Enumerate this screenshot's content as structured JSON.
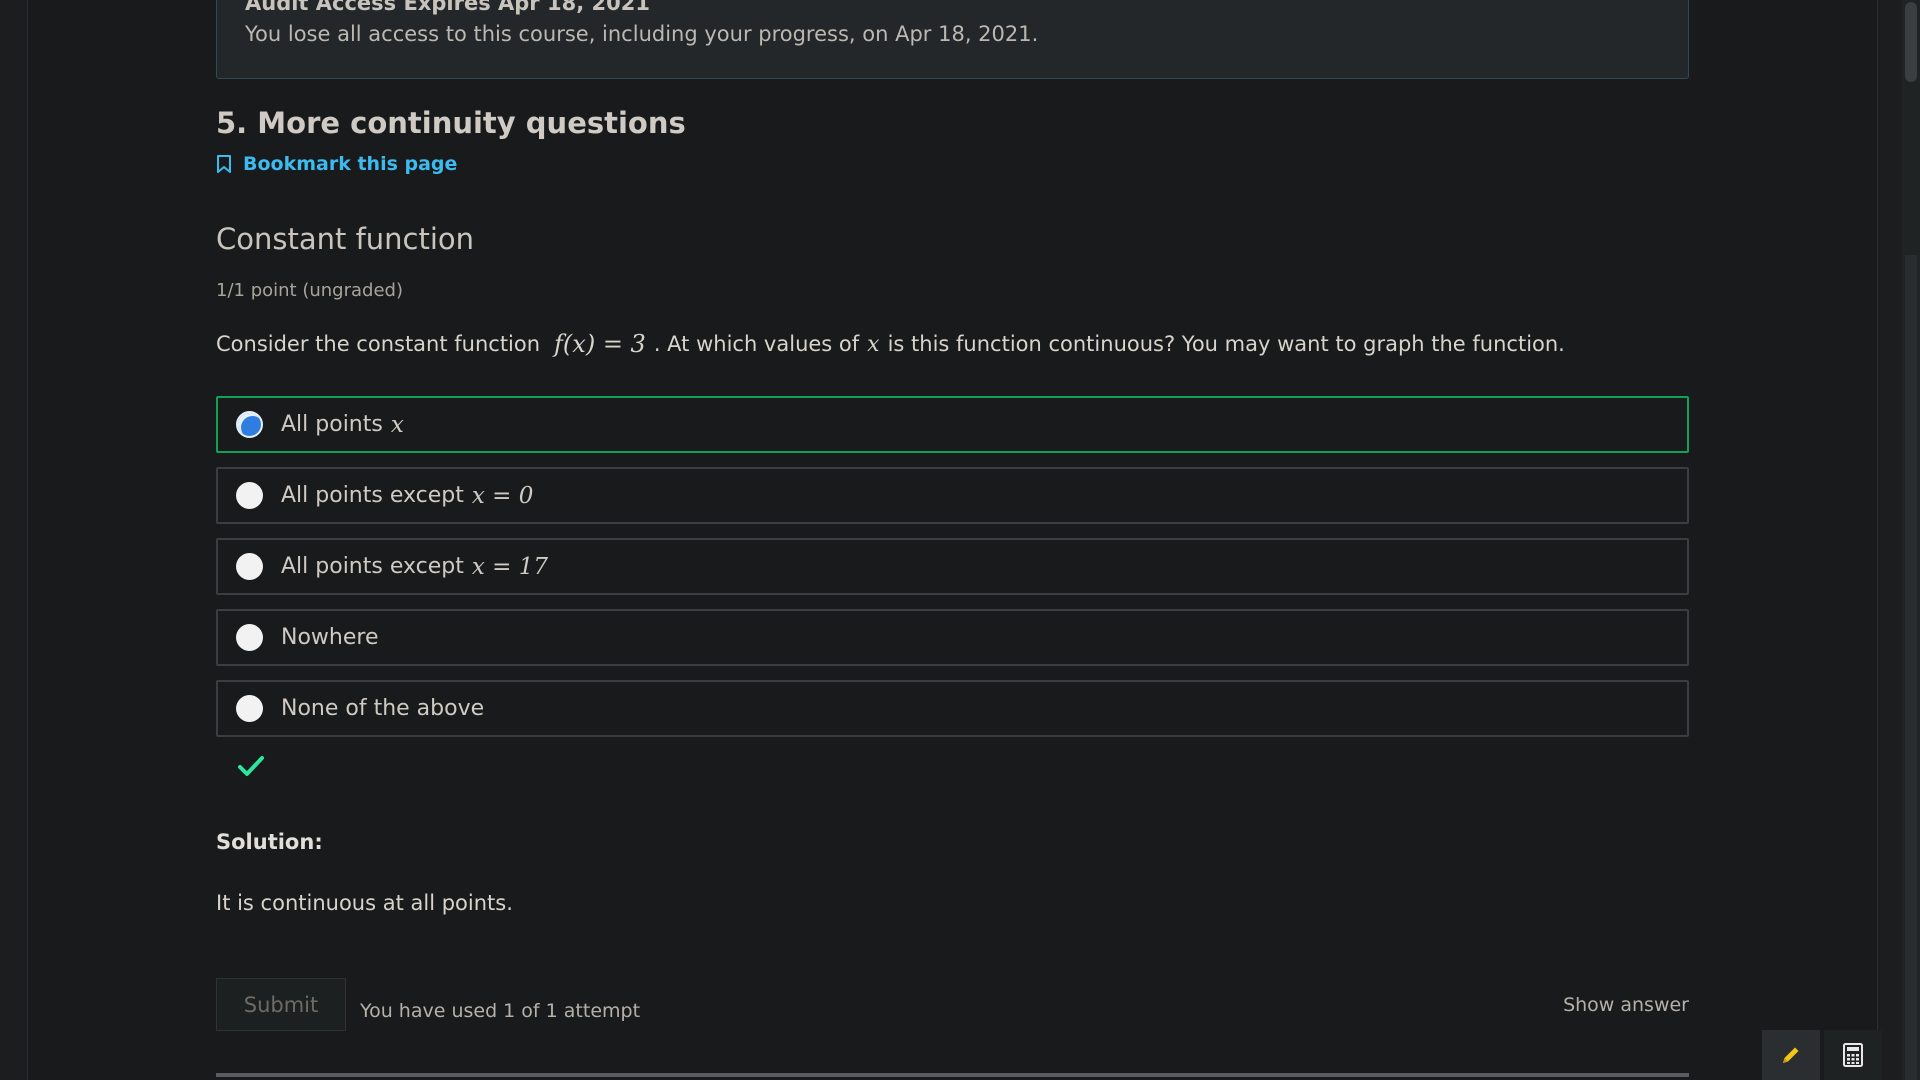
{
  "banner": {
    "title": "Audit Access Expires Apr 18, 2021",
    "text": "You lose all access to this course, including your progress, on Apr 18, 2021."
  },
  "unit": {
    "title": "5. More continuity questions",
    "bookmark_label": "Bookmark this page"
  },
  "problem": {
    "title": "Constant function",
    "points": "1/1 point (ungraded)",
    "question_before": "Consider the constant function",
    "question_math": "f(x) = 3",
    "question_middle": ". At which values of",
    "question_var": "x",
    "question_after": "is this function continuous? You may want to graph the function.",
    "options": [
      {
        "label": "All points",
        "math": "x",
        "selected": true,
        "correct": true
      },
      {
        "label": "All points except",
        "math": "x = 0",
        "selected": false,
        "correct": false
      },
      {
        "label": "All points except",
        "math": "x = 17",
        "selected": false,
        "correct": false
      },
      {
        "label": "Nowhere",
        "math": "",
        "selected": false,
        "correct": false
      },
      {
        "label": "None of the above",
        "math": "",
        "selected": false,
        "correct": false
      }
    ],
    "solution_label": "Solution:",
    "solution_text": "It is continuous at all points.",
    "submit_label": "Submit",
    "attempts_text": "You have used 1 of 1 attempt",
    "show_answer_label": "Show answer"
  },
  "colors": {
    "correct_border": "#10a058",
    "link": "#3dbbf0",
    "radio_selected": "#2f7de0",
    "checkmark": "#2ee59d",
    "notes_icon": "#f5c518"
  },
  "icons": {
    "bookmark": "bookmark-icon",
    "check": "checkmark-icon",
    "notes": "pencil-icon",
    "calculator": "calculator-icon"
  }
}
